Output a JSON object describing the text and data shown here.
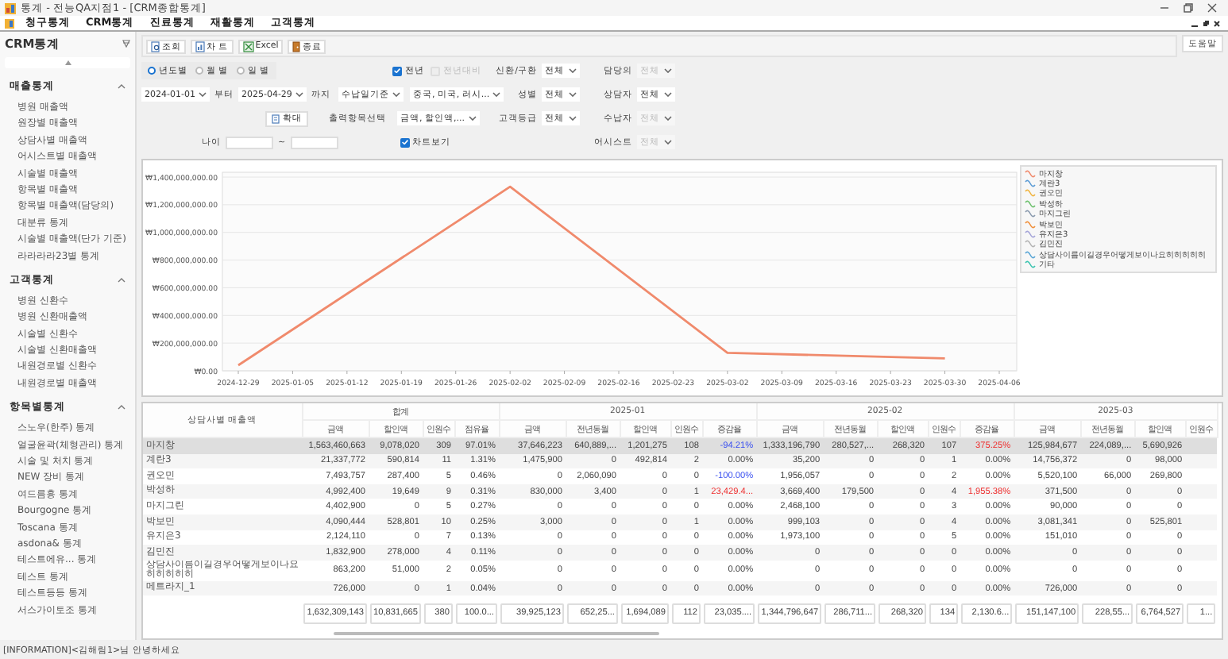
{
  "window": {
    "title": "통계 - 전능QA지점1 - [CRM종합통계]"
  },
  "menu": [
    "청구통계",
    "CRM통계",
    "진료통계",
    "재활통계",
    "고객통계"
  ],
  "sidebar": {
    "title": "CRM통계",
    "sections": [
      {
        "title": "매출통계",
        "expanded": true,
        "items": [
          "병원 매출액",
          "원장별 매출액",
          "상담사별 매출액",
          "어시스트별 매출액",
          "시술별 매출액",
          "항목별 매출액",
          "항목별 매출액(담당의)",
          "대분류 통계",
          "시술별 매출액(단가 기준)",
          "라라라라23별 통계"
        ]
      },
      {
        "title": "고객통계",
        "expanded": true,
        "items": [
          "병원 신환수",
          "병원 신환매출액",
          "시술별 신환수",
          "시술별 신환매출액",
          "내원경로별 신환수",
          "내원경로별 매출액"
        ]
      },
      {
        "title": "항목별통계",
        "expanded": true,
        "items": [
          "스노우(한주) 통계",
          "얼굴윤곽(체형관리) 통계",
          "시술 및 처치 통계",
          "NEW 장비 통계",
          "여드름흉 통계",
          "Bourgogne 통계",
          "Toscana 통계",
          "asdona& 통계",
          "테스트에유... 통계",
          "테스트 통계",
          "테스트등등 통계",
          "서스가이토조 통계"
        ]
      }
    ]
  },
  "toolbar": {
    "buttons": [
      {
        "label": "조회",
        "kind": "search"
      },
      {
        "label": "차 트",
        "kind": "chart"
      },
      {
        "label": "Excel",
        "kind": "excel"
      },
      {
        "label": "종료",
        "kind": "exit"
      }
    ],
    "help": "도움말"
  },
  "filters": {
    "period": [
      {
        "label": "년도별",
        "selected": true
      },
      {
        "label": "월 별",
        "selected": false
      },
      {
        "label": "일 별",
        "selected": false
      }
    ],
    "compare": [
      {
        "label": "전년",
        "checked": true,
        "disabled": false
      },
      {
        "label": "전년대비",
        "checked": false,
        "disabled": true
      }
    ],
    "date_from": "2024-01-01",
    "from_suffix": "부터",
    "date_to": "2025-04-29",
    "to_suffix": "까지",
    "date_basis": "수납일기준",
    "nationality": "중국, 미국, 러시...",
    "zoom_button": "확대",
    "output_label": "출력항목선택",
    "output_items": "금액, 할인액,...",
    "age_label": "나이",
    "age_sep": "~",
    "chart_toggle": {
      "label": "차트보기",
      "checked": true
    },
    "selects_a": [
      {
        "label": "신환/구환",
        "value": "전체",
        "disabled": false
      },
      {
        "label": "성별",
        "value": "전체",
        "disabled": false
      },
      {
        "label": "고객등급",
        "value": "전체",
        "disabled": false
      }
    ],
    "selects_b": [
      {
        "label": "담당의",
        "value": "전체",
        "disabled": true
      },
      {
        "label": "상담자",
        "value": "전체",
        "disabled": false
      },
      {
        "label": "수납자",
        "value": "전체",
        "disabled": true
      },
      {
        "label": "어시스트",
        "value": "전체",
        "disabled": true
      }
    ]
  },
  "chart": {
    "chart_data": {
      "type": "line",
      "categories": [
        "2024-12-29",
        "2025-01-05",
        "2025-01-12",
        "2025-01-19",
        "2025-01-26",
        "2025-02-02",
        "2025-02-09",
        "2025-02-16",
        "2025-02-23",
        "2025-03-02",
        "2025-03-09",
        "2025-03-16",
        "2025-03-23",
        "2025-03-30",
        "2025-04-06"
      ],
      "ylim": [
        0,
        1400000000
      ],
      "grid": true,
      "legend": "right",
      "yticks": [
        {
          "value": 0,
          "label": "₩0.00"
        },
        {
          "value": 200000000,
          "label": "₩200,000,000.00"
        },
        {
          "value": 400000000,
          "label": "₩400,000,000.00"
        },
        {
          "value": 600000000,
          "label": "₩600,000,000.00"
        },
        {
          "value": 800000000,
          "label": "₩800,000,000.00"
        },
        {
          "value": 1000000000,
          "label": "₩1,000,000,000.00"
        },
        {
          "value": 1200000000,
          "label": "₩1,200,000,000.00"
        },
        {
          "value": 1400000000,
          "label": "₩1,400,000,000.00"
        }
      ],
      "series": [
        {
          "name": "마지창",
          "color": "#f08a6c",
          "values": [
            40000000,
            null,
            null,
            null,
            null,
            1330000000,
            null,
            null,
            null,
            130000000,
            null,
            null,
            null,
            90000000,
            null
          ]
        },
        {
          "name": "계란3",
          "color": "#5b9bd5",
          "values": [
            null,
            null,
            null,
            null,
            null,
            null,
            null,
            null,
            null,
            null,
            null,
            null,
            null,
            null,
            null
          ]
        },
        {
          "name": "권오민",
          "color": "#f0b440",
          "values": [
            null,
            null,
            null,
            null,
            null,
            null,
            null,
            null,
            null,
            null,
            null,
            null,
            null,
            null,
            null
          ]
        },
        {
          "name": "박성하",
          "color": "#6cc06c",
          "values": [
            null,
            null,
            null,
            null,
            null,
            null,
            null,
            null,
            null,
            null,
            null,
            null,
            null,
            null,
            null
          ]
        },
        {
          "name": "마지그린",
          "color": "#8a9aae",
          "values": [
            null,
            null,
            null,
            null,
            null,
            null,
            null,
            null,
            null,
            null,
            null,
            null,
            null,
            null,
            null
          ]
        },
        {
          "name": "박보민",
          "color": "#f0903c",
          "values": [
            null,
            null,
            null,
            null,
            null,
            null,
            null,
            null,
            null,
            null,
            null,
            null,
            null,
            null,
            null
          ]
        },
        {
          "name": "유지은3",
          "color": "#a4a4d8",
          "values": [
            null,
            null,
            null,
            null,
            null,
            null,
            null,
            null,
            null,
            null,
            null,
            null,
            null,
            null,
            null
          ]
        },
        {
          "name": "김민진",
          "color": "#b4b4b4",
          "values": [
            null,
            null,
            null,
            null,
            null,
            null,
            null,
            null,
            null,
            null,
            null,
            null,
            null,
            null,
            null
          ]
        },
        {
          "name": "상담사이름이길경우어떻게보이나요히히히히히",
          "color": "#5aa6d6",
          "values": [
            null,
            null,
            null,
            null,
            null,
            null,
            null,
            null,
            null,
            null,
            null,
            null,
            null,
            null,
            null
          ]
        },
        {
          "name": "기타",
          "color": "#3cc4b0",
          "values": [
            null,
            null,
            null,
            null,
            null,
            null,
            null,
            null,
            null,
            null,
            null,
            null,
            null,
            null,
            null
          ]
        }
      ]
    }
  },
  "table": {
    "corner": "상담사별 매출액",
    "groups": [
      {
        "title": "합계",
        "columns": [
          "금액",
          "할인액",
          "인원수",
          "점유율"
        ]
      },
      {
        "title": "2025-01",
        "columns": [
          "금액",
          "전년동월",
          "할인액",
          "인원수",
          "증감율"
        ]
      },
      {
        "title": "2025-02",
        "columns": [
          "금액",
          "전년동월",
          "할인액",
          "인원수",
          "증감율"
        ]
      },
      {
        "title": "2025-03",
        "columns": [
          "금액",
          "전년동월",
          "할인액",
          "인원수"
        ]
      }
    ],
    "rows": [
      {
        "name": "마지창",
        "selected": true,
        "cells": [
          "1,563,460,663",
          "9,078,020",
          "309",
          "97.01%",
          "37,646,223",
          "640,889,...",
          "1,201,275",
          "108",
          {
            "text": "-94.21%",
            "color": "#3a50f0"
          },
          "1,333,196,790",
          "280,527,...",
          "268,320",
          "107",
          {
            "text": "375.25%",
            "color": "#ee3030"
          },
          "125,984,677",
          "224,089,...",
          "5,690,926"
        ]
      },
      {
        "name": "계란3",
        "selected": false,
        "cells": [
          "21,337,772",
          "590,814",
          "11",
          "1.31%",
          "1,475,900",
          "0",
          "492,814",
          "2",
          "0.00%",
          "35,200",
          "0",
          "0",
          "1",
          "0.00%",
          "14,756,372",
          "0",
          "98,000"
        ]
      },
      {
        "name": "권오민",
        "selected": false,
        "cells": [
          "7,493,757",
          "287,400",
          "5",
          "0.46%",
          "0",
          "2,060,090",
          "0",
          "0",
          {
            "text": "-100.00%",
            "color": "#3a50f0"
          },
          "1,956,057",
          "0",
          "0",
          "2",
          "0.00%",
          "5,520,100",
          "66,000",
          "269,800"
        ]
      },
      {
        "name": "박성하",
        "selected": false,
        "cells": [
          "4,992,400",
          "19,649",
          "9",
          "0.31%",
          "830,000",
          "3,400",
          "0",
          "1",
          {
            "text": "23,429.4...",
            "color": "#ee3030"
          },
          "3,669,400",
          "179,500",
          "0",
          "4",
          {
            "text": "1,955.38%",
            "color": "#ee3030"
          },
          "371,500",
          "0",
          "0"
        ]
      },
      {
        "name": "마지그린",
        "selected": false,
        "cells": [
          "4,402,900",
          "0",
          "5",
          "0.27%",
          "0",
          "0",
          "0",
          "0",
          "0.00%",
          "2,468,100",
          "0",
          "0",
          "3",
          "0.00%",
          "90,000",
          "0",
          "0"
        ]
      },
      {
        "name": "박보민",
        "selected": false,
        "cells": [
          "4,090,444",
          "528,801",
          "10",
          "0.25%",
          "3,000",
          "0",
          "0",
          "1",
          "0.00%",
          "999,103",
          "0",
          "0",
          "4",
          "0.00%",
          "3,081,341",
          "0",
          "525,801"
        ]
      },
      {
        "name": "유지은3",
        "selected": false,
        "cells": [
          "2,124,110",
          "0",
          "7",
          "0.13%",
          "0",
          "0",
          "0",
          "0",
          "0.00%",
          "1,973,100",
          "0",
          "0",
          "5",
          "0.00%",
          "151,010",
          "0",
          "0"
        ]
      },
      {
        "name": "김민진",
        "selected": false,
        "cells": [
          "1,832,900",
          "278,000",
          "4",
          "0.11%",
          "0",
          "0",
          "0",
          "0",
          "0.00%",
          "0",
          "0",
          "0",
          "0",
          "0.00%",
          "0",
          "0",
          "0"
        ]
      },
      {
        "name": "상담사이름이길경우어떻게보이나요히히히히히",
        "selected": false,
        "cells": [
          "863,200",
          "51,000",
          "2",
          "0.05%",
          "0",
          "0",
          "0",
          "0",
          "0.00%",
          "0",
          "0",
          "0",
          "0",
          "0.00%",
          "0",
          "0",
          "0"
        ]
      },
      {
        "name": "메트라지_1",
        "selected": false,
        "cells": [
          "726,000",
          "0",
          "1",
          "0.04%",
          "0",
          "0",
          "0",
          "0",
          "0.00%",
          "0",
          "0",
          "0",
          "0",
          "0.00%",
          "726,000",
          "0",
          "0"
        ]
      }
    ],
    "totals": [
      "1,632,309,143",
      "10,831,665",
      "380",
      "100.0...",
      "39,925,123",
      "652,25...",
      "1,694,089",
      "112",
      "23,035....",
      "1,344,796,647",
      "286,711...",
      "268,320",
      "134",
      "2,130.6...",
      "151,147,100",
      "228,55...",
      "6,764,527",
      "1..."
    ]
  },
  "status_bar": "[INFORMATION]<김해림1>님 안녕하세요"
}
